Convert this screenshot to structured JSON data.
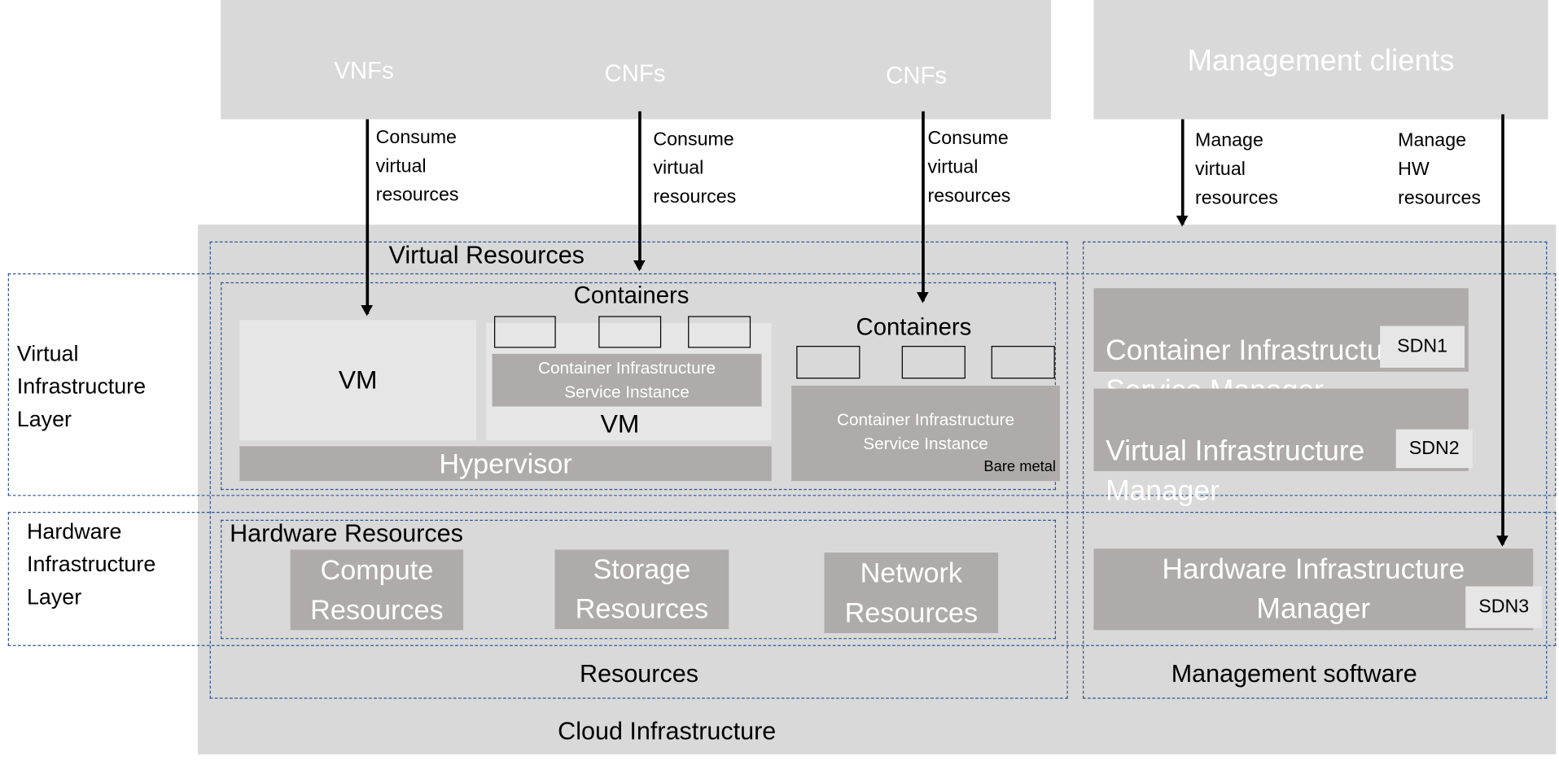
{
  "top": {
    "workloads": [
      "VNFs",
      "CNFs",
      "CNFs"
    ],
    "management_clients": "Management clients"
  },
  "arrows": {
    "consume1": "Consume\nvirtual\nresources",
    "consume2": "Consume\nvirtual\nresources",
    "consume3": "Consume\nvirtual\nresources",
    "manage_virtual": "Manage\nvirtual\nresources",
    "manage_hw": "Manage\nHW\nresources"
  },
  "layers": {
    "virtual": "Virtual\nInfrastructure\nLayer",
    "hardware": "Hardware\nInfrastructure\nLayer"
  },
  "cloud": {
    "title": "Cloud Infrastructure",
    "resources_label": "Resources",
    "virtual_resources": "Virtual Resources",
    "containers_outer": "Containers",
    "vm1": "VM",
    "cisi_vm": "Container Infrastructure\nService Instance",
    "vm2": "VM",
    "hypervisor": "Hypervisor",
    "containers_bm": "Containers",
    "cisi_bm": "Container Infrastructure\nService Instance",
    "bare_metal": "Bare metal",
    "hardware_resources": "Hardware Resources",
    "compute": "Compute\nResources",
    "storage": "Storage\nResources",
    "network": "Network\nResources"
  },
  "management": {
    "label": "Management software",
    "cism": "Container Infrastructure\nService Manager",
    "sdn1": "SDN1",
    "vim": "Virtual Infrastructure\n Manager",
    "sdn2": "SDN2",
    "him": "Hardware Infrastructure\nManager",
    "sdn3": "SDN3"
  },
  "colors": {
    "background": "#d9d9d9",
    "box": "#afabab",
    "light_box": "#e7e6e6",
    "dashed": "#2f5597"
  }
}
